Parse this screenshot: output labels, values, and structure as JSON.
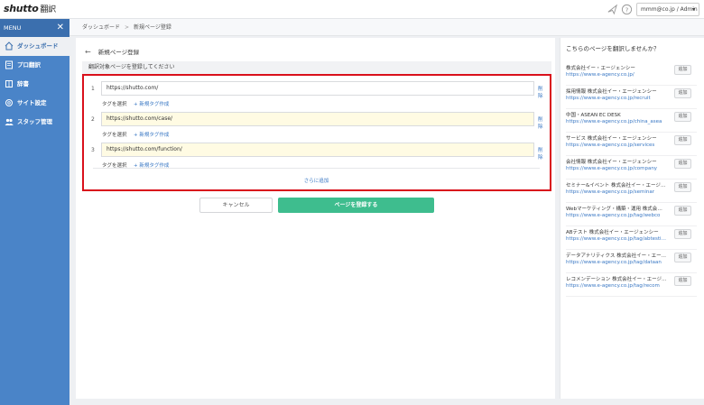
{
  "app": {
    "logo_main": "shutto",
    "logo_sub": "翻訳",
    "user": "mmm@co.jp / Admin"
  },
  "sidebar": {
    "menu_label": "MENU",
    "items": [
      {
        "label": "ダッシュボード",
        "icon": "home-icon",
        "active": true
      },
      {
        "label": "プロ翻訳",
        "icon": "document-icon"
      },
      {
        "label": "辞書",
        "icon": "book-icon"
      },
      {
        "label": "サイト設定",
        "icon": "gear-icon"
      },
      {
        "label": "スタッフ管理",
        "icon": "users-icon"
      }
    ]
  },
  "breadcrumb": {
    "items": [
      "ダッシュボード",
      "新規ページ登録"
    ]
  },
  "main": {
    "title": "新規ページ登録",
    "section_label": "翻訳対象ページを登録してください",
    "entries": [
      {
        "num": "1",
        "url": "https://shutto.com/",
        "highlighted": false
      },
      {
        "num": "2",
        "url": "https://shutto.com/case/",
        "highlighted": true
      },
      {
        "num": "3",
        "url": "https://shutto.com/function/",
        "highlighted": true
      }
    ],
    "delete_label": "削除",
    "tag_select_label": "タグを選択",
    "tag_new_label": "+ 新規タグ作成",
    "add_more_label": "さらに追加",
    "cancel_label": "キャンセル",
    "submit_label": "ページを登録する"
  },
  "right_panel": {
    "title": "こちらのページを翻訳しませんか？",
    "add_label": "追加",
    "sites": [
      {
        "name": "株式会社イー・エージェンシー",
        "url": "https://www.e-agency.co.jp/"
      },
      {
        "name": "採用情報 株式会社イー・エージェンシー",
        "url": "https://www.e-agency.co.jp/recruit"
      },
      {
        "name": "中国・ASEAN EC DESK",
        "url": "https://www.e-agency.co.jp/china_asea"
      },
      {
        "name": "サービス 株式会社イー・エージェンシー",
        "url": "https://www.e-agency.co.jp/services"
      },
      {
        "name": "会社情報 株式会社イー・エージェンシー",
        "url": "https://www.e-agency.co.jp/company"
      },
      {
        "name": "セミナー&イベント 株式会社イー・エージェン...",
        "url": "https://www.e-agency.co.jp/seminar"
      },
      {
        "name": "Webマーケティング・構築・運用 株式会社イー...",
        "url": "https://www.e-agency.co.jp/tag/webco"
      },
      {
        "name": "ABテスト 株式会社イー・エージェンシー",
        "url": "https://www.e-agency.co.jp/tag/abtesting"
      },
      {
        "name": "データアナリティクス 株式会社イー・エージェ...",
        "url": "https://www.e-agency.co.jp/tag/dataan"
      },
      {
        "name": "レコメンデーション 株式会社イー・エージェンシ...",
        "url": "https://www.e-agency.co.jp/tag/recom"
      }
    ]
  },
  "colors": {
    "sidebar": "#4a84c8",
    "accent": "#3ebd8e",
    "highlight": "#d9101b",
    "link": "#3a78c4"
  }
}
